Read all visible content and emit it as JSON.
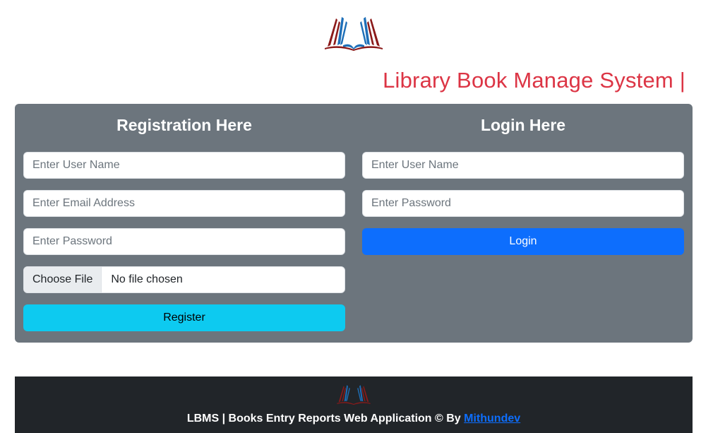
{
  "brand": {
    "logo_icon": "open-book-icon",
    "title": "Library Book Manage System |",
    "colors": {
      "title": "#dc3545",
      "logo_red": "#8b1a1a",
      "logo_blue": "#1e6fb8"
    }
  },
  "registration": {
    "heading": "Registration Here",
    "username_placeholder": "Enter User Name",
    "email_placeholder": "Enter Email Address",
    "password_placeholder": "Enter Password",
    "file_button": "Choose File",
    "file_status": "No file chosen",
    "submit_label": "Register"
  },
  "login": {
    "heading": "Login Here",
    "username_placeholder": "Enter User Name",
    "password_placeholder": "Enter Password",
    "submit_label": "Login"
  },
  "footer": {
    "logo_icon": "open-book-icon",
    "text": "LBMS | Books Entry Reports Web Application © By ",
    "link_text": "Mithundev"
  },
  "colors": {
    "panel_bg": "#6c757d",
    "register_btn": "#0dcaf0",
    "login_btn": "#0d6efd",
    "footer_bg": "#212529"
  }
}
